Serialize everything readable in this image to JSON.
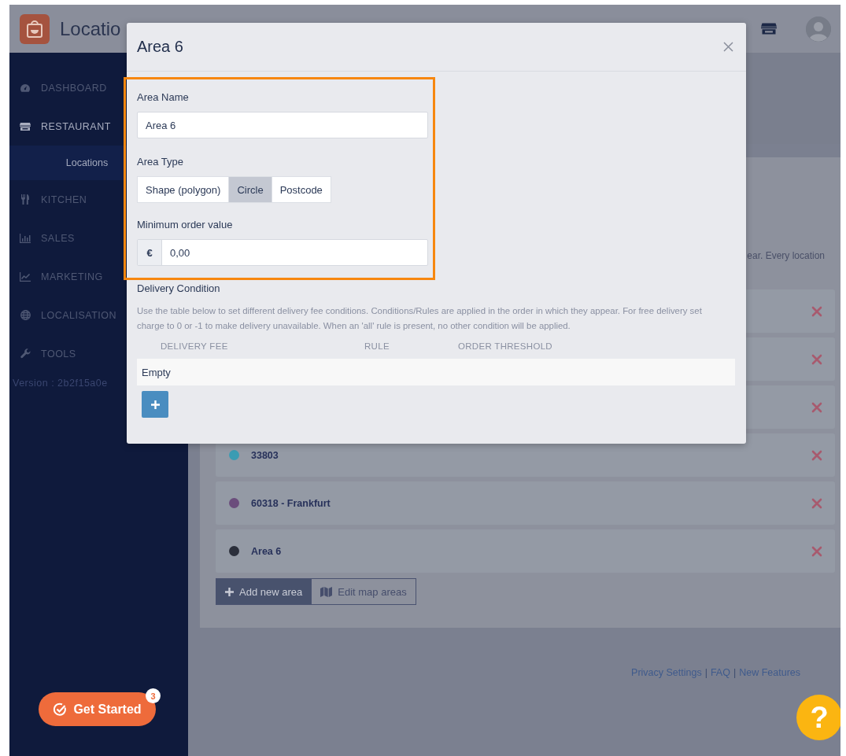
{
  "header": {
    "title": "Locatio"
  },
  "sidebar": {
    "items": [
      {
        "label": "DASHBOARD",
        "selected": false
      },
      {
        "label": "RESTAURANT",
        "selected": true,
        "children": [
          {
            "label": "Locations",
            "selected": true
          }
        ]
      },
      {
        "label": "KITCHEN",
        "selected": false
      },
      {
        "label": "SALES",
        "selected": false
      },
      {
        "label": "MARKETING",
        "selected": false
      },
      {
        "label": "LOCALISATION",
        "selected": false
      },
      {
        "label": "TOOLS",
        "selected": false
      }
    ],
    "version": "Version : 2b2f15a0e"
  },
  "main": {
    "description_fragment": "ear. Every location",
    "areas": [
      {
        "kind": "covered"
      },
      {
        "kind": "covered"
      },
      {
        "kind": "covered"
      },
      {
        "kind": "named",
        "name": "33803",
        "color": "#3b9cb3"
      },
      {
        "kind": "named",
        "name": "60318 - Frankfurt",
        "color": "#6b4d7c"
      },
      {
        "kind": "named",
        "name": "Area 6",
        "color": "#2b2f3b"
      }
    ],
    "buttons": [
      {
        "label": "Add new area",
        "kind": "primary"
      },
      {
        "label": "Edit map areas",
        "kind": "outline"
      }
    ]
  },
  "footer": {
    "items": [
      {
        "kind": "link",
        "text": "Privacy Settings"
      },
      {
        "kind": "separator",
        "text": "|"
      },
      {
        "kind": "link",
        "text": "FAQ"
      },
      {
        "kind": "separator",
        "text": "|"
      },
      {
        "kind": "link",
        "text": "New Features"
      }
    ]
  },
  "get_started": {
    "label": "Get Started",
    "badge": "3"
  },
  "help_button": {
    "label": "?"
  },
  "modal": {
    "title": "Area 6",
    "highlighted": true,
    "area_name": {
      "label": "Area Name",
      "value": "Area 6"
    },
    "area_type": {
      "label": "Area Type",
      "options": [
        {
          "label": "Shape (polygon)",
          "selected": false
        },
        {
          "label": "Circle",
          "selected": true
        },
        {
          "label": "Postcode",
          "selected": false
        }
      ]
    },
    "minimum_order": {
      "label": "Minimum order value",
      "prefix": "€",
      "value": "0,00"
    },
    "delivery_condition": {
      "title": "Delivery Condition",
      "description": "Use the table below to set different delivery fee conditions. Conditions/Rules are applied in the order in which they appear. For free delivery set charge to 0 or -1 to make delivery unavailable. When an 'all' rule is present, no other condition will be applied.",
      "columns": [
        "DELIVERY FEE",
        "RULE",
        "ORDER THRESHOLD"
      ],
      "empty_text": "Empty"
    }
  }
}
